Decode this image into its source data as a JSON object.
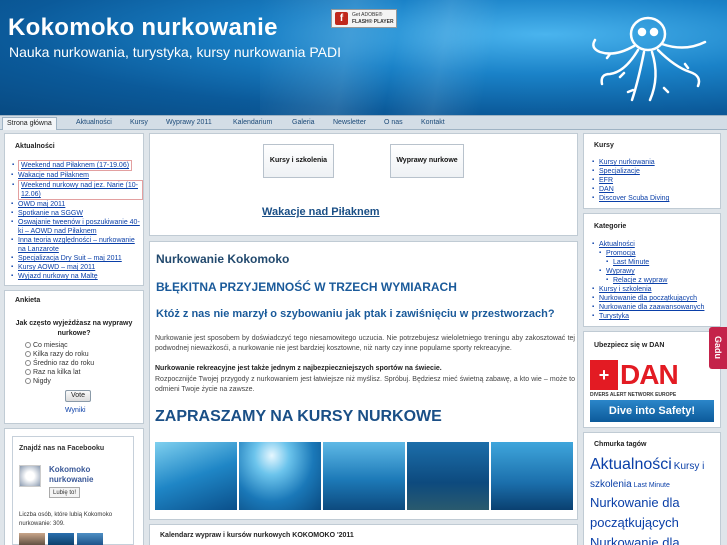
{
  "header": {
    "title": "Kokomoko nurkowanie",
    "subtitle": "Nauka nurkowania, turystyka, kursy nurkowania PADI",
    "flash_line1": "Get ADOBE®",
    "flash_line2": "FLASH® PLAYER"
  },
  "nav": {
    "items": [
      "Strona główna",
      "Aktualności",
      "Kursy",
      "Wyprawy 2011",
      "Kalendarium",
      "Galeria",
      "Newsletter",
      "O nas",
      "Kontakt"
    ]
  },
  "left": {
    "news_title": "Aktualności",
    "news": [
      "Weekend nad Piłaknem (17-19.06)",
      "Wakacje nad Piłaknem",
      "Weekend nurkowy nad jez. Narie (10-12.06)",
      "OWD maj 2011",
      "Spotkanie na SGGW",
      "Oswajanie tweenów i poszukiwanie 40-ki – AOWD nad Piłaknem",
      "Inna teoria względności – nurkowanie na Lanzarote",
      "Specjalizacja Dry Suit – maj 2011",
      "Kursy AOWD – maj 2011",
      "Wyjazd nurkowy na Maltę"
    ],
    "poll_title": "Ankieta",
    "poll_question": "Jak często wyjeżdżasz na wyprawy nurkowe?",
    "poll_options": [
      "Co miesiąc",
      "Kilka razy do roku",
      "Średnio raz do roku",
      "Raz na kilka lat",
      "Nigdy"
    ],
    "vote_label": "Vote",
    "results_label": "Wyniki",
    "fb_title": "Znajdź nas na Facebooku",
    "fb_name": "Kokomoko nurkowanie",
    "fb_like": "Lubię to!",
    "fb_count_text": "Liczba osób, które lubią Kokomoko nurkowanie: 309."
  },
  "main": {
    "thumb1": "Kursy i szkolenia",
    "thumb2": "Wyprawy nurkowe",
    "summer_link": "Wakacje nad Piłaknem",
    "heading": "Nurkowanie Kokomoko",
    "slogan": "BŁĘKITNA PRZYJEMNOŚĆ W TRZECH WYMIARACH",
    "question": "Któż z nas nie marzył o szybowaniu jak ptak i zawiśnięciu w przestworzach?",
    "para1": "Nurkowanie jest sposobem by doświadczyć tego niesamowitego uczucia. Nie potrzebujesz wieloletniego treningu aby zakosztować tej podwodnej nieważkosći, a nurkowanie nie jest bardziej kosztowne, niż narty czy inne popularne sporty rekreacyjne.",
    "para2_bold": "Nurkowanie rekreacyjne jest także jednym z najbezpieczniejszych sportów na świecie.",
    "para3": "Rozpocznijće Twojej przygody z nurkowaniem jest łatwiejsze niż myślisz. Spróbuj. Będziesz mieć świetną zabawę, a kto wie – może to odmieni Twoje życie na zawsze.",
    "invite": "ZAPRASZAMY NA KURSY NURKOWE",
    "calendar_title": "Kalendarz wypraw i kursów nurkowych KOKOMOKO '2011"
  },
  "right": {
    "courses_title": "Kursy",
    "courses": [
      "Kursy nurkowania",
      "Specjalizacje",
      "EFR",
      "DAN",
      "Discover Scuba Diving"
    ],
    "categories_title": "Kategorie",
    "categories": [
      {
        "label": "Aktualności",
        "level": 0
      },
      {
        "label": "Promocja",
        "level": 1
      },
      {
        "label": "Last Minute",
        "level": 2
      },
      {
        "label": "Wyprawy",
        "level": 1
      },
      {
        "label": "Relacje z wypraw",
        "level": 2
      },
      {
        "label": "Kursy i szkolenia",
        "level": 0
      },
      {
        "label": "Nurkowanie dla początkujących",
        "level": 0
      },
      {
        "label": "Nurkowanie dla zaawansowanych",
        "level": 0
      },
      {
        "label": "Turystyka",
        "level": 0
      }
    ],
    "dan_title": "Ubezpiecz się w DAN",
    "dan_word": "DAN",
    "dan_network": "DIVERS ALERT NETWORK EUROPE",
    "dan_safe": "Dive into Safety!",
    "tags_title": "Chmurka tagów",
    "tags": [
      "Aktualności",
      "Kursy i szkolenia",
      "Last Minute",
      "Nurkowanie dla początkujących",
      "Nurkowanie dla"
    ],
    "side_tab": "Gadu"
  },
  "colors": {
    "header_dark": "#0b5a9a",
    "link": "#0a3fa8",
    "heading": "#1a4f86",
    "dan_red": "#e31b23"
  }
}
